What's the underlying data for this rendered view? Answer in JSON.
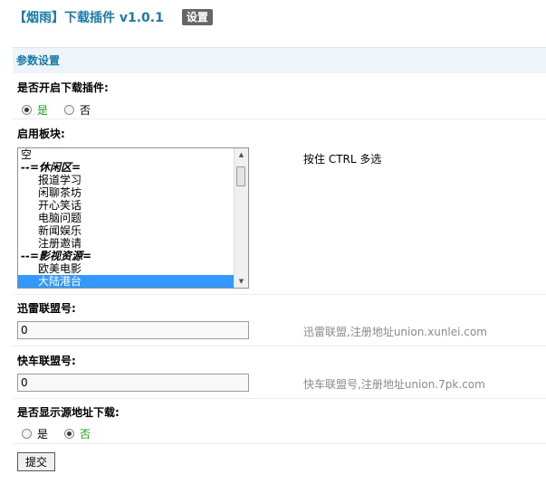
{
  "header": {
    "plugin_title": "【烟雨】下载插件 v1.0.1",
    "settings_tag": "设置"
  },
  "section": {
    "title": "参数设置"
  },
  "enable_plugin": {
    "label": "是否开启下载插件:",
    "options": [
      {
        "label": "是",
        "checked": true
      },
      {
        "label": "否",
        "checked": false
      }
    ]
  },
  "boards": {
    "label": "启用板块:",
    "hint": "按住 CTRL 多选",
    "items": [
      {
        "label": "空",
        "type": "item",
        "selected": false
      },
      {
        "label": "--=休闲区=",
        "type": "group",
        "selected": false
      },
      {
        "label": "报道学习",
        "type": "sub",
        "selected": false
      },
      {
        "label": "闲聊茶坊",
        "type": "sub",
        "selected": false
      },
      {
        "label": "开心笑话",
        "type": "sub",
        "selected": false
      },
      {
        "label": "电脑问题",
        "type": "sub",
        "selected": false
      },
      {
        "label": "新闻娱乐",
        "type": "sub",
        "selected": false
      },
      {
        "label": "注册邀请",
        "type": "sub",
        "selected": false
      },
      {
        "label": "--=影视资源=",
        "type": "group",
        "selected": false
      },
      {
        "label": "欧美电影",
        "type": "sub",
        "selected": false
      },
      {
        "label": "大陆港台",
        "type": "sub",
        "selected": true
      }
    ]
  },
  "xunlei": {
    "label": "迅雷联盟号:",
    "value": "0",
    "hint": "迅雷联盟,注册地址union.xunlei.com"
  },
  "kuaiche": {
    "label": "快车联盟号:",
    "value": "0",
    "hint": "快车联盟号,注册地址union.7pk.com"
  },
  "show_source": {
    "label": "是否显示源地址下载:",
    "options": [
      {
        "label": "是",
        "checked": false
      },
      {
        "label": "否",
        "checked": true
      }
    ]
  },
  "submit": {
    "label": "提交"
  },
  "colors": {
    "accent": "#1a7ba8",
    "selected_option": "#19a019",
    "list_highlight": "#3399ff"
  }
}
